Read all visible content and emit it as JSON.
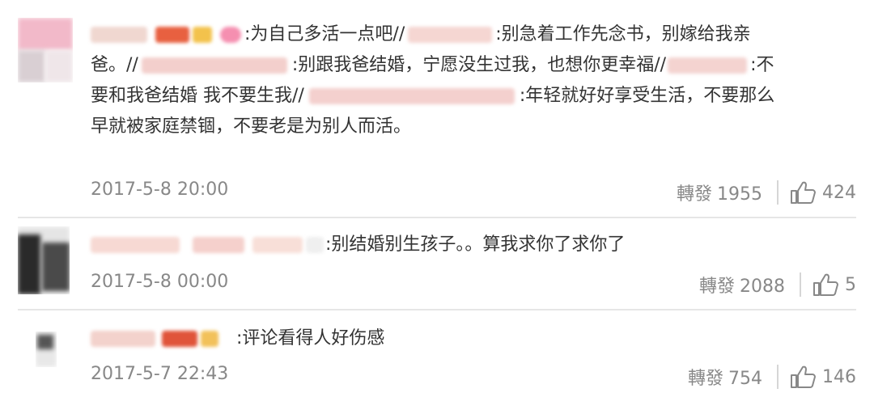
{
  "comments": [
    {
      "text_1": ":为自己多活一点吧//",
      "text_2": ":别急着工作先念书，别嫁给我亲",
      "text_3": "爸。//",
      "text_4": ":别跟我爸结婚，宁愿没生过我，也想你更幸福//",
      "text_5": ":不",
      "text_6": "要和我爸结婚 我不要生我//",
      "text_7": ":年轻就好好享受生活，不要那么",
      "text_8": "早就被家庭禁锢，不要老是为别人而活。",
      "time": "2017-5-8 20:00",
      "repost_label": "轉發",
      "repost_count": "1955",
      "like_count": "424"
    },
    {
      "text_1": ":别结婚别生孩子。。算我求你了求你了",
      "time": "2017-5-8 00:00",
      "repost_label": "轉發",
      "repost_count": "2088",
      "like_count": "5"
    },
    {
      "text_1": ":评论看得人好伤感",
      "time": "2017-5-7 22:43",
      "repost_label": "轉發",
      "repost_count": "754",
      "like_count": "146"
    }
  ],
  "icons": {
    "like": "thumbs-up-icon"
  }
}
